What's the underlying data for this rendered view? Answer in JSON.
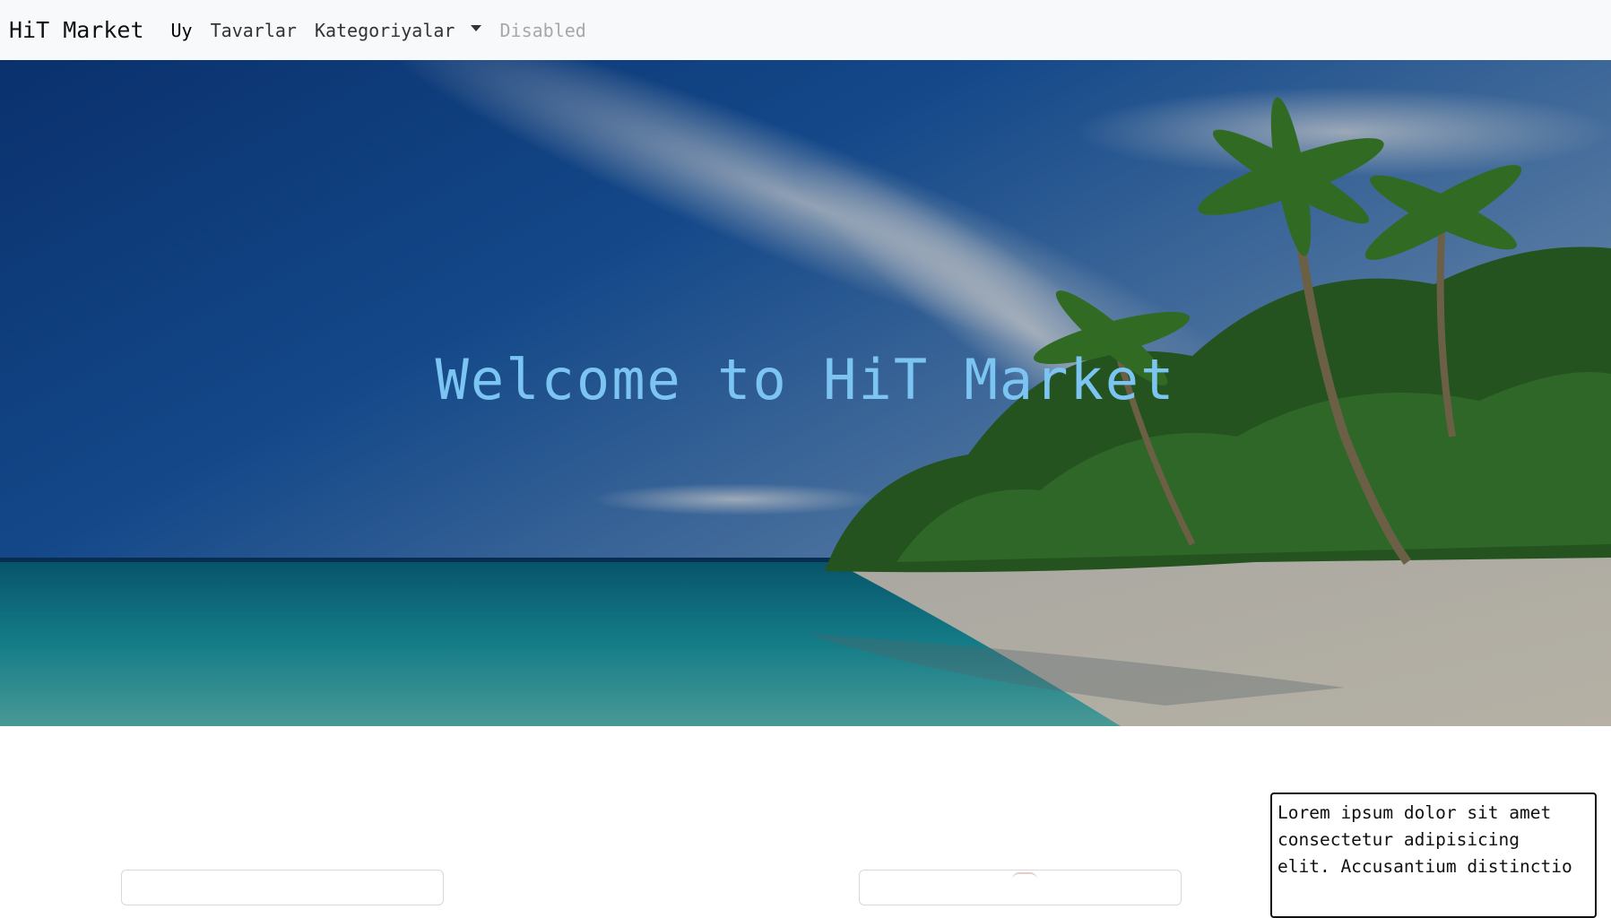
{
  "navbar": {
    "brand": "HiT Market",
    "links": [
      {
        "label": "Uy",
        "state": "active"
      },
      {
        "label": "Tavarlar",
        "state": "normal"
      },
      {
        "label": "Kategoriyalar",
        "state": "dropdown"
      },
      {
        "label": "Disabled",
        "state": "disabled"
      }
    ],
    "dropdown_icon": "caret-down-icon"
  },
  "hero": {
    "title": "Welcome to HiT Market",
    "title_color": "#7cc4f2",
    "background": "tropical beach with palm trees"
  },
  "content": {
    "text_box": "Lorem ipsum dolor sit amet\nconsectetur adipisicing\nelit. Accusantium distinctio"
  },
  "colors": {
    "navbar_bg": "#f8f9fa",
    "disabled_link": "#a6a8ab"
  }
}
